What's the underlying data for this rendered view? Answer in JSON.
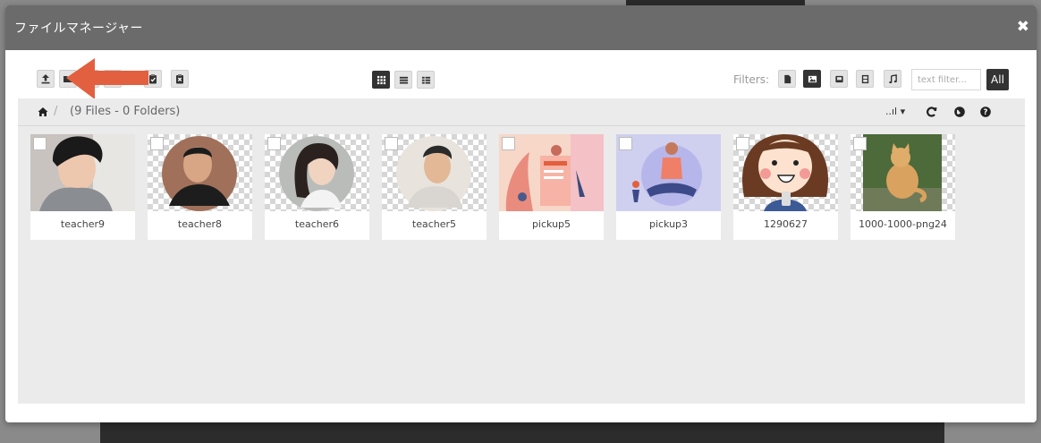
{
  "window": {
    "title": "ファイルマネージャー",
    "close_glyph": "✖"
  },
  "toolbar": {
    "upload_icon": "upload-icon",
    "paste_icon": "clipboard-icon",
    "clear_clipboard_icon": "clipboard-clear-icon",
    "views": [
      "grid-view",
      "list-view",
      "columns-view"
    ],
    "active_view": "grid-view"
  },
  "filters": {
    "label": "Filters:",
    "buttons": [
      "file-filter",
      "image-filter",
      "archive-filter",
      "video-filter",
      "music-filter"
    ],
    "active": "image-filter",
    "placeholder": "text filter...",
    "all_label": "All"
  },
  "breadcrumb": {
    "separator": "/",
    "summary": "(9 Files - 0 Folders)"
  },
  "sort": {
    "glyph": "..ıl ▾"
  },
  "files": [
    {
      "name": "teacher9"
    },
    {
      "name": "teacher8"
    },
    {
      "name": "teacher6"
    },
    {
      "name": "teacher5"
    },
    {
      "name": "pickup5"
    },
    {
      "name": "pickup3"
    },
    {
      "name": "1290627"
    },
    {
      "name": "1000-1000-png24"
    }
  ],
  "annotation": {
    "color": "#e2603f",
    "shape": "arrow-left"
  }
}
